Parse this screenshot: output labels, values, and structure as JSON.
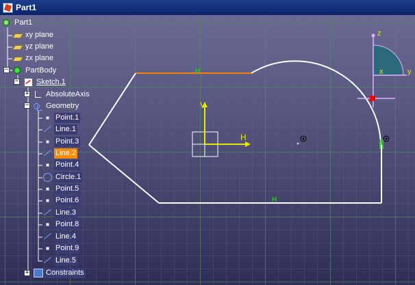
{
  "window": {
    "title": "Part1"
  },
  "tree": {
    "root": "Part1",
    "planes": [
      "xy plane",
      "yz plane",
      "zx plane"
    ],
    "body": "PartBody",
    "sketch": "Sketch.1",
    "absolute_axis": "AbsoluteAxis",
    "geometry": "Geometry",
    "geometry_items": [
      {
        "label": "Point.1",
        "icon": "point-icon"
      },
      {
        "label": "Line.1",
        "icon": "line-icon"
      },
      {
        "label": "Point.3",
        "icon": "point-icon"
      },
      {
        "label": "Line.2",
        "icon": "line-icon"
      },
      {
        "label": "Point.4",
        "icon": "point-icon"
      },
      {
        "label": "Circle.1",
        "icon": "circle-icon"
      },
      {
        "label": "Point.5",
        "icon": "point-icon"
      },
      {
        "label": "Point.6",
        "icon": "point-icon"
      },
      {
        "label": "Line.3",
        "icon": "line-icon"
      },
      {
        "label": "Point.8",
        "icon": "point-icon"
      },
      {
        "label": "Line.4",
        "icon": "line-icon"
      },
      {
        "label": "Point.9",
        "icon": "point-icon"
      },
      {
        "label": "Line.5",
        "icon": "line-icon"
      }
    ],
    "selected_item": "Line.2",
    "constraints": "Constraints",
    "expander_open": "−",
    "expander_closed": "+"
  },
  "sketch": {
    "sketch_axis": {
      "v_label": "V",
      "h_label": "H"
    },
    "constraint_marks": [
      "H",
      "H"
    ],
    "compass": {
      "z_label": "z",
      "x_label": "x",
      "y_label": "y"
    },
    "colors": {
      "profile": "#ffffff",
      "selected_line": "#ff8000",
      "constraint": "#2fbf2f",
      "sketch_axis": "#e8e800",
      "compass_axis": "#e0b0ff",
      "compass_fill": "#2a6a7a",
      "origin_point": "#ff0000"
    }
  }
}
